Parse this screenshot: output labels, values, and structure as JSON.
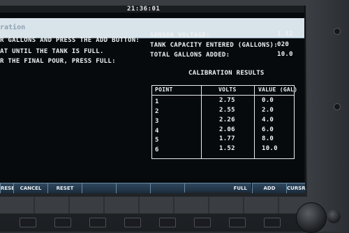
{
  "clock": "21:36:01",
  "title_fragment": "ration",
  "instructions": [
    "R GALLONS AND PRESS THE ADD BUTTON:",
    "AT UNTIL THE TANK IS FULL.",
    "R THE FINAL POUR, PRESS FULL:"
  ],
  "status": {
    "sensor_voltage_label": "SENSOR VOLTAGE:",
    "sensor_voltage_value": "1.52",
    "tank_capacity_label": "TANK CAPACITY ENTERED (GALLONS):",
    "tank_capacity_value": "020",
    "total_gallons_label": "TOTAL GALLONS ADDED:",
    "total_gallons_value": "10.0"
  },
  "results": {
    "heading": "CALIBRATION RESULTS",
    "columns": [
      "POINT",
      "VOLTS",
      "VALUE (GAL)"
    ],
    "rows": [
      {
        "point": "1",
        "volts": "2.75",
        "value": "0.0"
      },
      {
        "point": "2",
        "volts": "2.55",
        "value": "2.0"
      },
      {
        "point": "3",
        "volts": "2.26",
        "value": "4.0"
      },
      {
        "point": "4",
        "volts": "2.06",
        "value": "6.0"
      },
      {
        "point": "5",
        "volts": "1.77",
        "value": "8.0"
      },
      {
        "point": "6",
        "volts": "1.52",
        "value": "10.0"
      }
    ]
  },
  "softkeys": [
    "RESET",
    "CANCEL",
    "RESET",
    "",
    "",
    "",
    "FULL",
    "ADD",
    "CURSR"
  ],
  "colors": {
    "screen_bg": "#060a0d",
    "text": "#eef2f4",
    "titlebar": "#d9e3ea",
    "softkey": "#2f4860"
  }
}
